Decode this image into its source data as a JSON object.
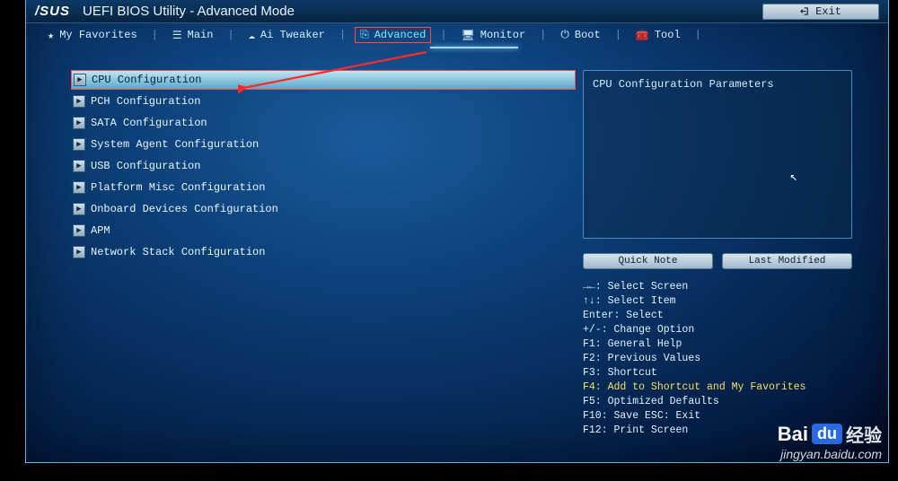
{
  "brand": "/SUS",
  "title": "UEFI BIOS Utility - Advanced Mode",
  "exit_label": "Exit",
  "tabs": [
    {
      "label": "My Favorites"
    },
    {
      "label": "Main"
    },
    {
      "label": "Ai Tweaker"
    },
    {
      "label": "Advanced"
    },
    {
      "label": "Monitor"
    },
    {
      "label": "Boot"
    },
    {
      "label": "Tool"
    }
  ],
  "active_tab_index": 3,
  "menu": [
    "CPU Configuration",
    "PCH Configuration",
    "SATA Configuration",
    "System Agent Configuration",
    "USB Configuration",
    "Platform Misc Configuration",
    "Onboard Devices Configuration",
    "APM",
    "Network Stack Configuration"
  ],
  "selected_menu_index": 0,
  "info_title": "CPU Configuration Parameters",
  "quick_note_label": "Quick Note",
  "last_modified_label": "Last Modified",
  "help": {
    "l1": "→←: Select Screen",
    "l2": "↑↓: Select Item",
    "l3": "Enter: Select",
    "l4": "+/-: Change Option",
    "l5": "F1: General Help",
    "l6": "F2: Previous Values",
    "l7": "F3: Shortcut",
    "l8": "F4: Add to Shortcut and My Favorites",
    "l9": "F5: Optimized Defaults",
    "l10": "F10: Save ESC: Exit",
    "l11": "F12: Print Screen"
  },
  "watermark": {
    "cn": "经验",
    "url": "jingyan.baidu.com",
    "bai": "Bai",
    "du": "du"
  },
  "footer": ""
}
